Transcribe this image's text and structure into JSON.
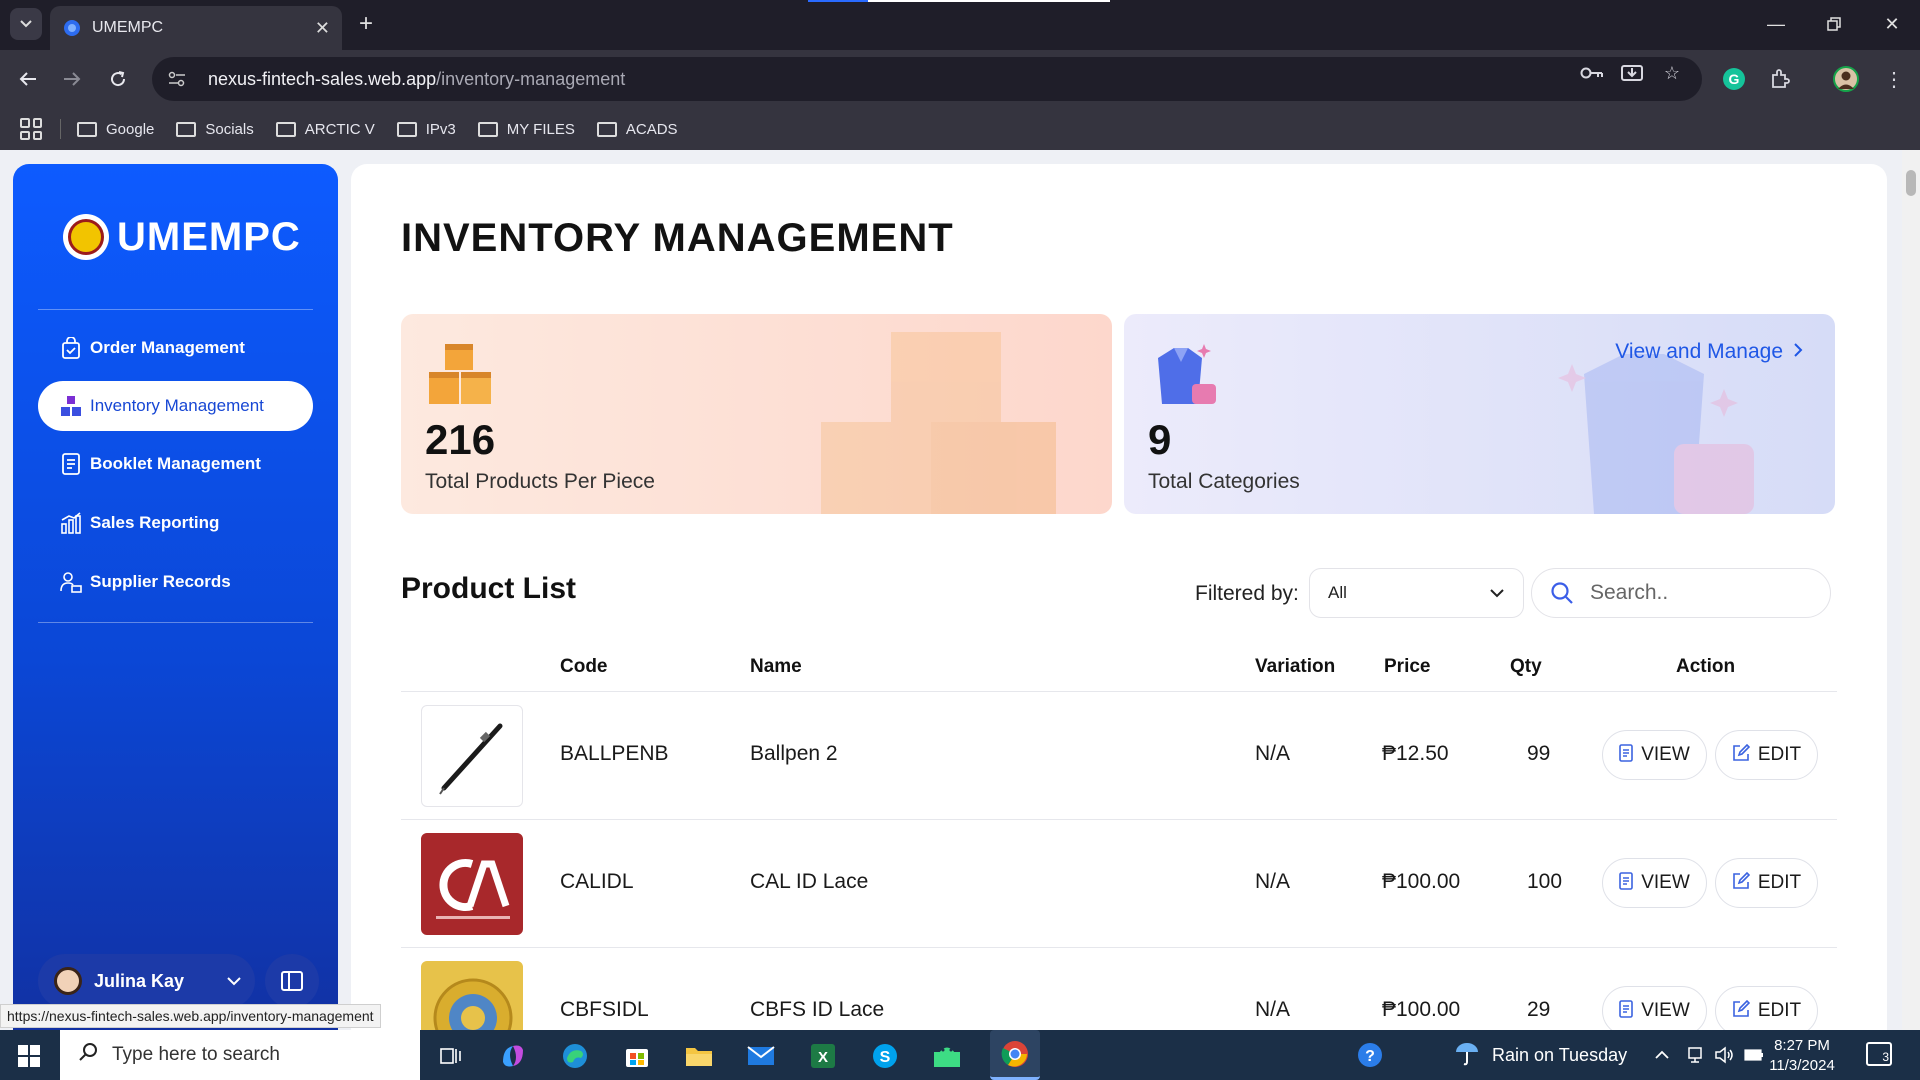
{
  "browser": {
    "tab_title": "UMEMPC",
    "url_host": "nexus-fintech-sales.web.app",
    "url_path": "/inventory-management",
    "bookmarks": [
      "Google",
      "Socials",
      "ARCTIC V",
      "IPv3",
      "MY FILES",
      "ACADS"
    ],
    "status_url": "https://nexus-fintech-sales.web.app/inventory-management"
  },
  "sidebar": {
    "brand": "UMEMPC",
    "items": [
      {
        "label": "Order Management",
        "icon": "shopping-bag-icon"
      },
      {
        "label": "Inventory Management",
        "icon": "boxes-icon"
      },
      {
        "label": "Booklet Management",
        "icon": "booklet-icon"
      },
      {
        "label": "Sales Reporting",
        "icon": "bar-chart-icon"
      },
      {
        "label": "Supplier Records",
        "icon": "supplier-icon"
      }
    ],
    "user_name": "Julina Kay"
  },
  "main": {
    "title": "INVENTORY MANAGEMENT",
    "stats": {
      "products_value": "216",
      "products_label": "Total Products Per Piece",
      "categories_value": "9",
      "categories_label": "Total Categories",
      "view_manage": "View and Manage"
    },
    "product_list": {
      "title": "Product List",
      "filter_label": "Filtered by:",
      "filter_value": "All",
      "search_placeholder": "Search..",
      "columns": {
        "code": "Code",
        "name": "Name",
        "variation": "Variation",
        "price": "Price",
        "qty": "Qty",
        "action": "Action"
      },
      "rows": [
        {
          "code": "BALLPENB",
          "name": "Ballpen 2",
          "variation": "N/A",
          "price": "₱12.50",
          "qty": "99"
        },
        {
          "code": "CALIDL",
          "name": "CAL ID Lace",
          "variation": "N/A",
          "price": "₱100.00",
          "qty": "100"
        },
        {
          "code": "CBFSIDL",
          "name": "CBFS ID Lace",
          "variation": "N/A",
          "price": "₱100.00",
          "qty": "29"
        }
      ],
      "view_label": "VIEW",
      "edit_label": "EDIT"
    }
  },
  "taskbar": {
    "search_placeholder": "Type here to search",
    "weather": "Rain on Tuesday",
    "time": "8:27 PM",
    "date": "11/3/2024",
    "notifications": "3"
  },
  "colors": {
    "sidebar_blue": "#0d5bff",
    "accent": "#1f57e6",
    "browser_dark": "#35343f"
  }
}
